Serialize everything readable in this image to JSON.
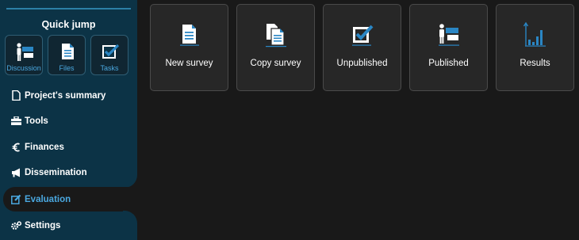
{
  "sidebar": {
    "quick_jump_title": "Quick jump",
    "quick_jump": [
      {
        "label": "Discussion",
        "icon": "discussion-icon"
      },
      {
        "label": "Files",
        "icon": "file-icon"
      },
      {
        "label": "Tasks",
        "icon": "tasks-icon"
      }
    ],
    "items": [
      {
        "label": "Project's summary",
        "icon": "file-icon"
      },
      {
        "label": "Tools",
        "icon": "toolbox-icon"
      },
      {
        "label": "Finances",
        "icon": "euro-icon"
      },
      {
        "label": "Dissemination",
        "icon": "megaphone-icon"
      },
      {
        "label": "Evaluation",
        "icon": "edit-icon",
        "active": true
      },
      {
        "label": "Settings",
        "icon": "gears-icon"
      }
    ]
  },
  "cards": [
    {
      "label": "New survey",
      "icon": "new-survey-icon"
    },
    {
      "label": "Copy survey",
      "icon": "copy-survey-icon"
    },
    {
      "label": "Unpublished",
      "icon": "unpublished-icon"
    },
    {
      "label": "Published",
      "icon": "published-icon"
    },
    {
      "label": "Results",
      "icon": "results-icon"
    }
  ],
  "colors": {
    "sidebar_bg": "#0c3346",
    "main_bg": "#191919",
    "card_bg": "#272727",
    "accent": "#4aa8e0"
  }
}
